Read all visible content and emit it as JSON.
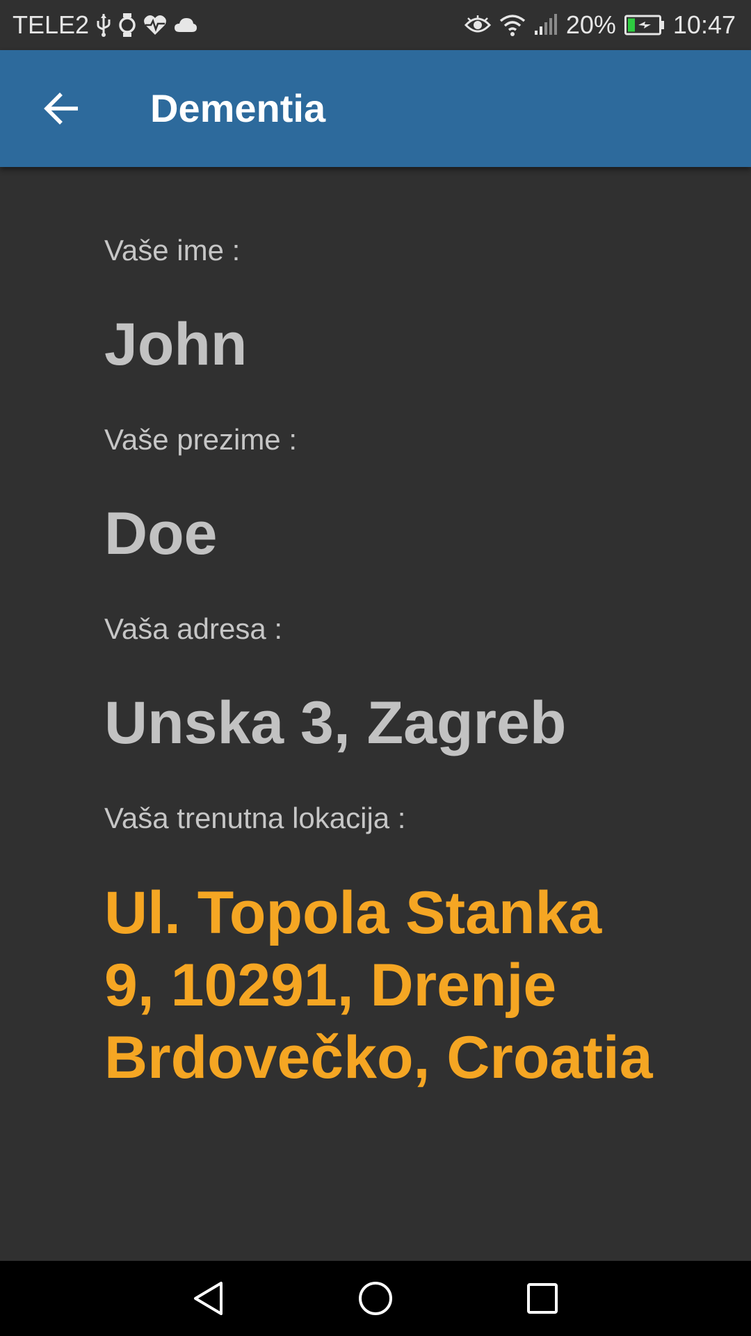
{
  "status_bar": {
    "carrier": "TELE2",
    "battery_percent": "20%",
    "time": "10:47",
    "icons_left": [
      "usb-icon",
      "watch-icon",
      "heart-rate-icon",
      "cloud-icon"
    ],
    "icons_right": [
      "eye-icon",
      "wifi-icon",
      "signal-icon",
      "battery-charging-icon"
    ]
  },
  "app_bar": {
    "title": "Dementia",
    "background_color": "#2d6a9c",
    "back_icon": "arrow-back-icon"
  },
  "profile": {
    "first_name_label": "Vaše ime :",
    "first_name": "John",
    "last_name_label": "Vaše prezime :",
    "last_name": "Doe",
    "address_label": "Vaša adresa :",
    "address": "Unska 3,  Zagreb",
    "location_label": "Vaša trenutna lokacija :",
    "location_line1": "Ul. Topola Stanka",
    "location_line2": "9, 10291, Drenje",
    "location_line3": "Brdovečko, Croatia",
    "location_color": "#f5a623"
  },
  "nav_bar": {
    "buttons": [
      "back-triangle-icon",
      "home-circle-icon",
      "recents-square-icon"
    ]
  }
}
